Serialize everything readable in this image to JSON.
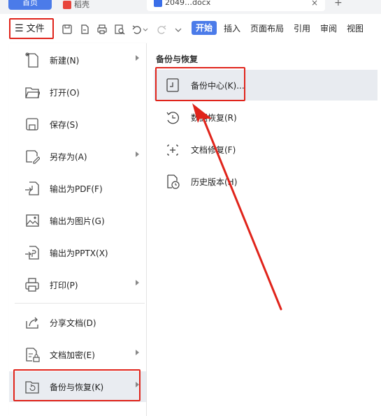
{
  "tabs": {
    "home": "首页",
    "doc2": "稻壳",
    "doc1": "2049…docx",
    "close": "×",
    "plus": "+"
  },
  "toolbar": {
    "file_label": "文件",
    "ribbon_tabs": [
      "开始",
      "插入",
      "页面布局",
      "引用",
      "审阅",
      "视图"
    ]
  },
  "menu": {
    "items": [
      {
        "label": "新建(N)",
        "icon": "new-doc-icon",
        "submenu": true
      },
      {
        "label": "打开(O)",
        "icon": "folder-open-icon",
        "submenu": false
      },
      {
        "label": "保存(S)",
        "icon": "save-icon",
        "submenu": false
      },
      {
        "label": "另存为(A)",
        "icon": "save-as-icon",
        "submenu": true
      },
      {
        "label": "输出为PDF(F)",
        "icon": "export-pdf-icon",
        "submenu": false
      },
      {
        "label": "输出为图片(G)",
        "icon": "export-image-icon",
        "submenu": false
      },
      {
        "label": "输出为PPTX(X)",
        "icon": "export-pptx-icon",
        "submenu": false
      },
      {
        "label": "打印(P)",
        "icon": "print-icon",
        "submenu": true
      },
      {
        "label": "分享文档(D)",
        "icon": "share-icon",
        "submenu": false
      },
      {
        "label": "文档加密(E)",
        "icon": "encrypt-icon",
        "submenu": true
      },
      {
        "label": "备份与恢复(K)",
        "icon": "backup-restore-icon",
        "submenu": true
      }
    ]
  },
  "submenu": {
    "title": "备份与恢复",
    "items": [
      {
        "label": "备份中心(K)...",
        "icon": "backup-center-icon"
      },
      {
        "label": "数据恢复(R)",
        "icon": "data-recovery-icon"
      },
      {
        "label": "文档修复(F)",
        "icon": "doc-repair-icon"
      },
      {
        "label": "历史版本(H)",
        "icon": "history-version-icon"
      }
    ]
  },
  "colors": {
    "accent": "#4b7be9",
    "highlight_box": "#e0241b",
    "active_bg": "#e9ecf1"
  }
}
